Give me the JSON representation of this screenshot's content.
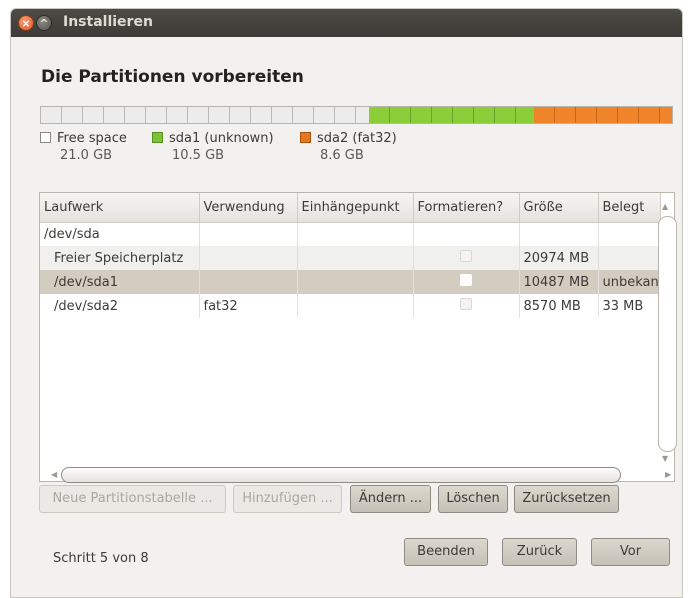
{
  "window": {
    "title": "Installieren"
  },
  "heading": "Die Partitionen vorbereiten",
  "partitions_bar": {
    "segments": [
      {
        "name": "Free space",
        "fraction": 0.52,
        "color": "#ececec"
      },
      {
        "name": "sda1 (unknown)",
        "fraction": 0.262,
        "color": "#8ccd3a"
      },
      {
        "name": "sda2 (fat32)",
        "fraction": 0.218,
        "color": "#f0842a"
      }
    ]
  },
  "legend": [
    {
      "label": "Free space",
      "size": "21.0 GB",
      "color": "#ffffff"
    },
    {
      "label": "sda1 (unknown)",
      "size": "10.5 GB",
      "color": "#7cc235"
    },
    {
      "label": "sda2 (fat32)",
      "size": "8.6 GB",
      "color": "#e8781e"
    }
  ],
  "table": {
    "headers": [
      "Laufwerk",
      "Verwendung",
      "Einhängepunkt",
      "Formatieren?",
      "Größe",
      "Belegt"
    ],
    "rows": [
      {
        "device": "/dev/sda",
        "usage": "",
        "mount": "",
        "size": "",
        "used": ""
      },
      {
        "device": "Freier Speicherplatz",
        "usage": "",
        "mount": "",
        "size": "20974 MB",
        "used": ""
      },
      {
        "device": "/dev/sda1",
        "usage": "",
        "mount": "",
        "size": "10487 MB",
        "used": "unbekannt"
      },
      {
        "device": "/dev/sda2",
        "usage": "fat32",
        "mount": "",
        "size": "8570 MB",
        "used": "33 MB"
      }
    ]
  },
  "buttons": {
    "new_table": "Neue Partitionstabelle ...",
    "add": "Hinzufügen ...",
    "change": "Ändern ...",
    "delete": "Löschen",
    "reset": "Zurücksetzen",
    "quit": "Beenden",
    "back": "Zurück",
    "forward": "Vor"
  },
  "step": "Schritt 5 von 8"
}
